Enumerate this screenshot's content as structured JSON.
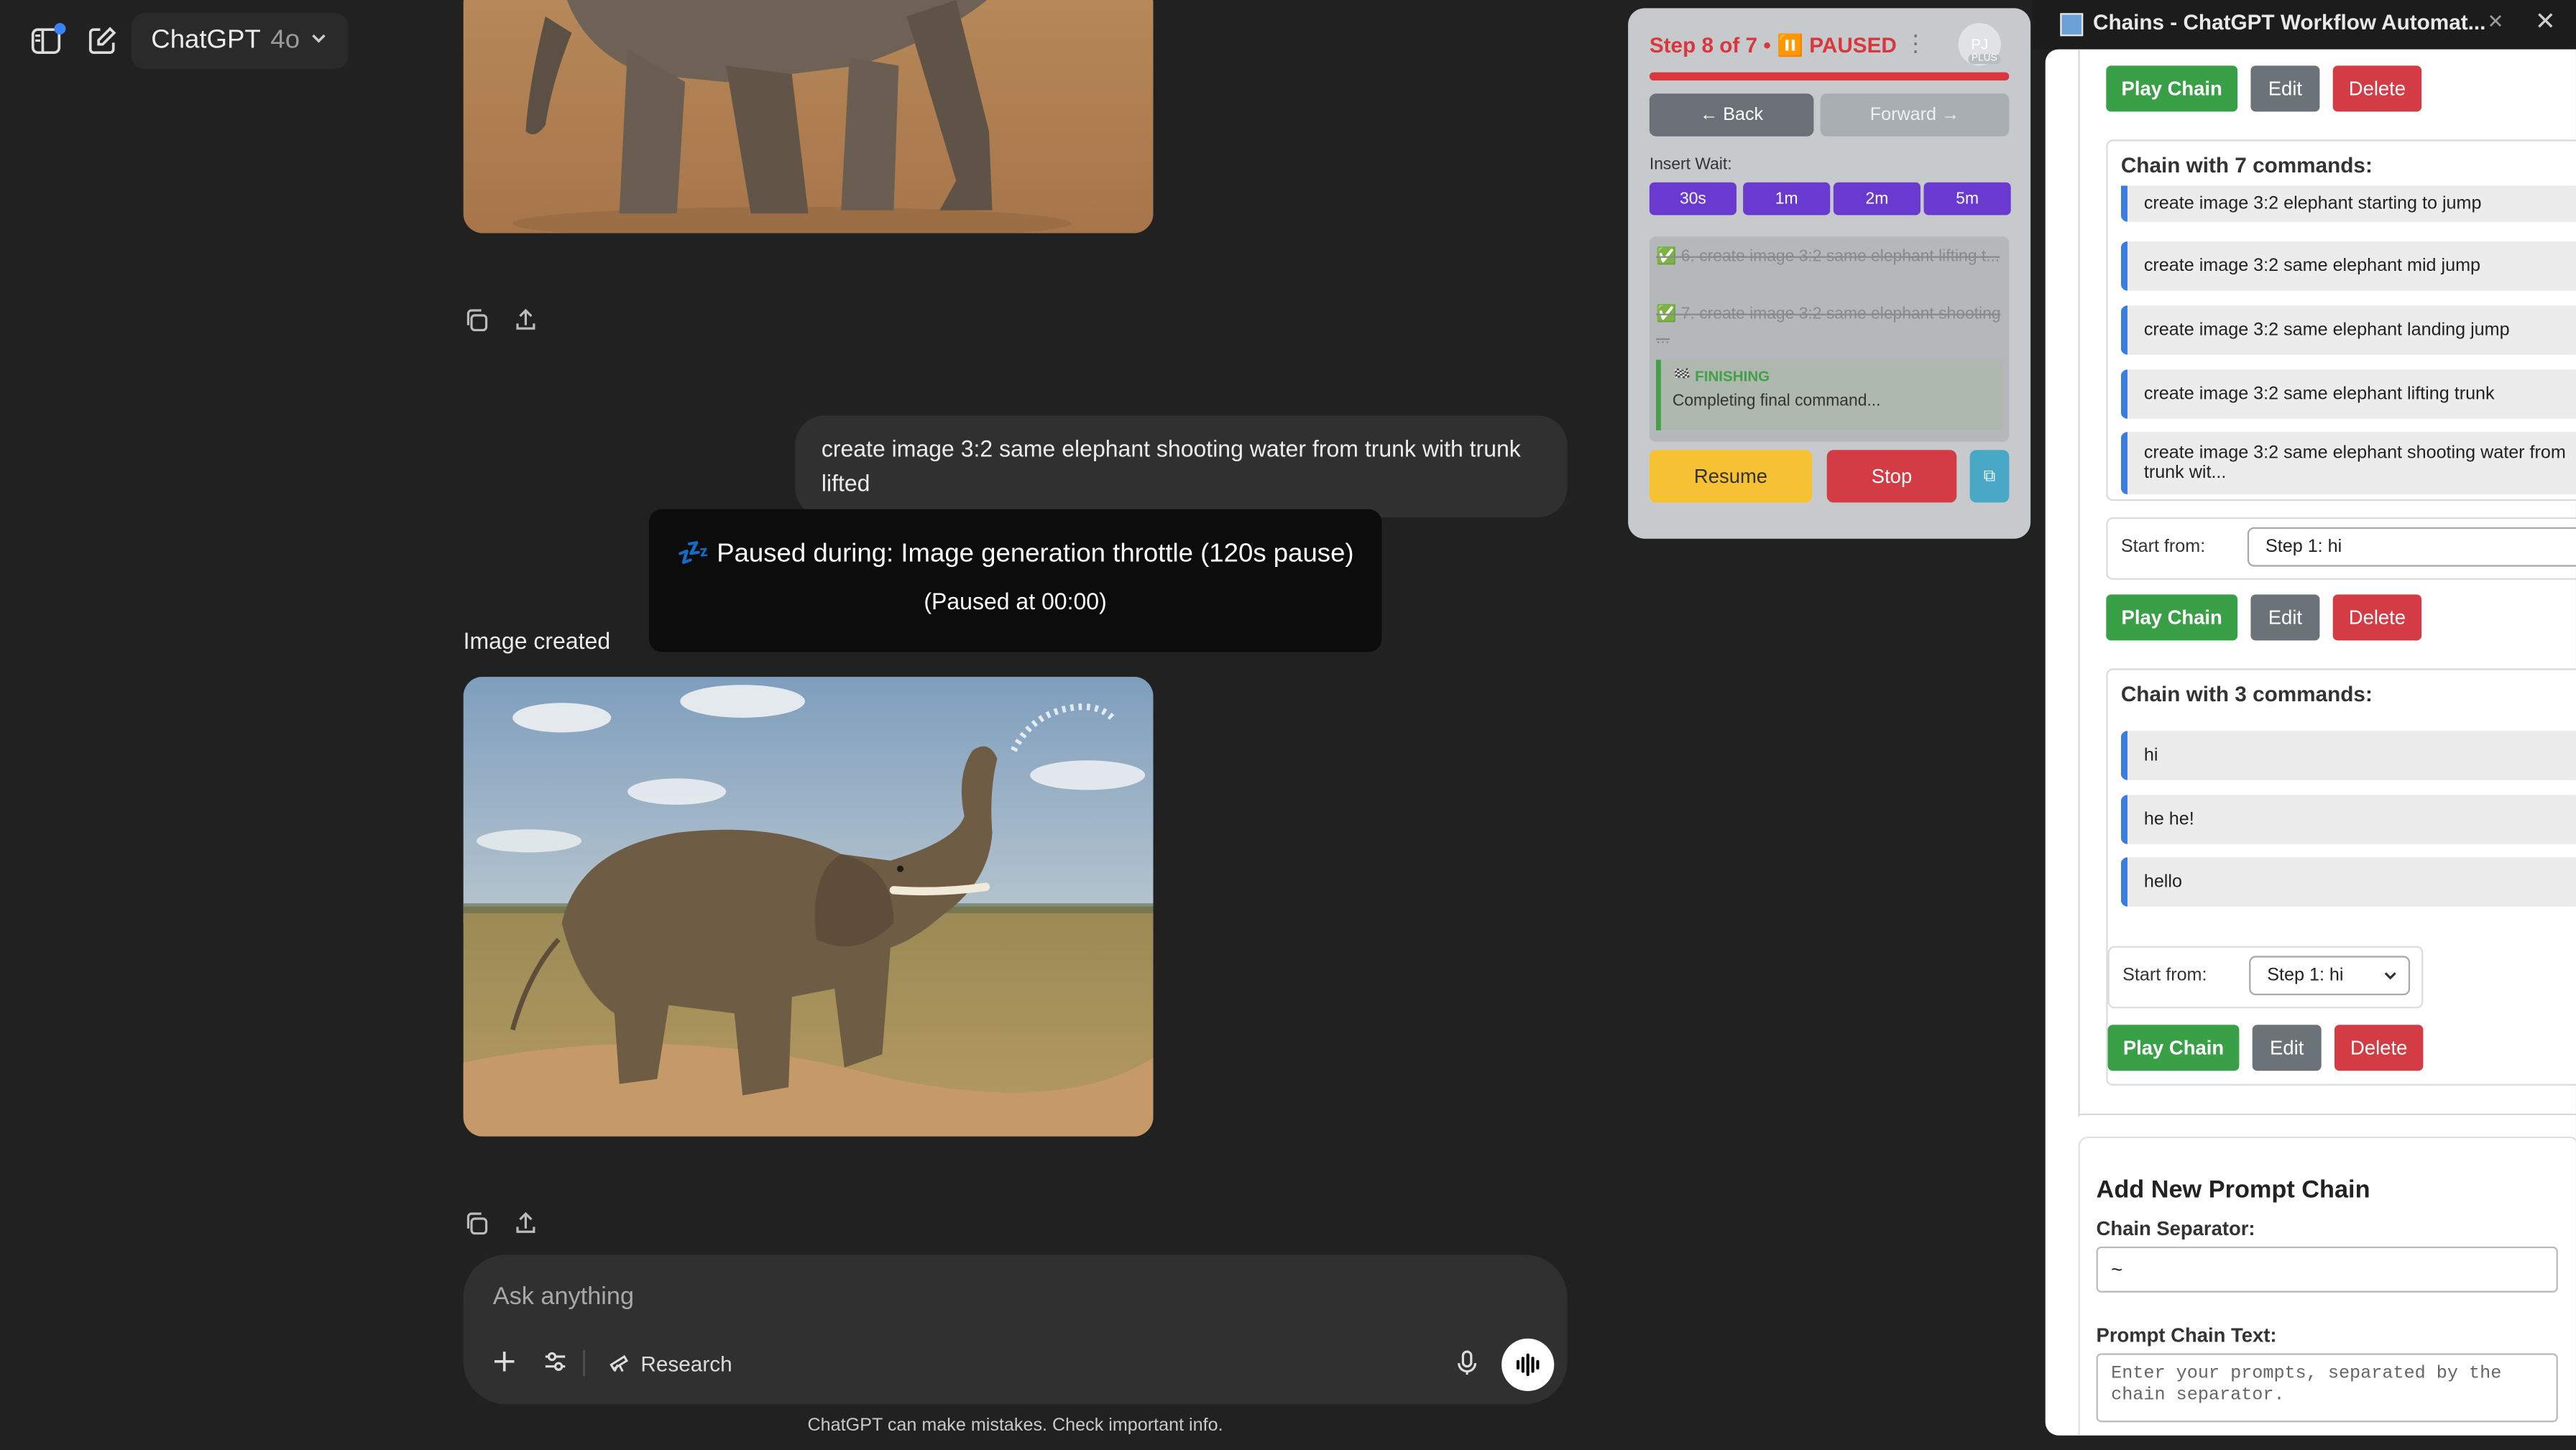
{
  "header": {
    "model_name": "ChatGPT",
    "model_version": "4o"
  },
  "chat": {
    "user_message": "create image 3:2 same elephant shooting water from trunk with trunk lifted",
    "image_label": "Image created",
    "pause_tooltip": {
      "line1": "💤 Paused during: Image generation throttle (120s pause)",
      "line2": "(Paused at 00:00)"
    },
    "composer_placeholder": "Ask anything",
    "research_label": "Research",
    "disclaimer": "ChatGPT can make mistakes. Check important info."
  },
  "widget": {
    "status": "Step 8 of 7 • ⏸️ PAUSED",
    "avatar_initials": "PJ",
    "avatar_badge": "PLUS",
    "back_label": "← Back",
    "forward_label": "Forward →",
    "insert_wait_label": "Insert Wait:",
    "wait_options": [
      "30s",
      "1m",
      "2m",
      "5m"
    ],
    "log": {
      "done_1": "✅ 6. create image 3:2 same elephant lifting t...",
      "done_2": "✅ 7. create image 3:2 same elephant shooting ...",
      "finishing_title": "🏁 FINISHING",
      "finishing_text": "Completing final command..."
    },
    "resume_label": "Resume",
    "stop_label": "Stop",
    "progress": 1.0
  },
  "panel": {
    "title": "Chains - ChatGPT Workflow Automat...",
    "top_buttons": {
      "play": "Play Chain",
      "edit": "Edit",
      "delete": "Delete"
    },
    "chain7": {
      "title": "Chain with 7 commands:",
      "commands": [
        "create image 3:2 elephant starting to jump",
        "create image 3:2 same elephant mid jump",
        "create image 3:2 same elephant landing jump",
        "create image 3:2 same elephant lifting trunk",
        "create image 3:2 same elephant shooting water from trunk wit..."
      ],
      "start_label": "Start from:",
      "start_value": "Step 1: hi",
      "play": "Play Chain",
      "edit": "Edit",
      "delete": "Delete"
    },
    "chain3": {
      "title": "Chain with 3 commands:",
      "commands": [
        "hi",
        "he he!",
        "hello"
      ],
      "start_label": "Start from:",
      "start_value": "Step 1: hi",
      "play": "Play Chain",
      "edit": "Edit",
      "delete": "Delete"
    },
    "add_new": {
      "heading": "Add New Prompt Chain",
      "separator_label": "Chain Separator:",
      "separator_value": "~",
      "text_label": "Prompt Chain Text:",
      "text_placeholder": "Enter your prompts, separated by the chain separator."
    }
  }
}
